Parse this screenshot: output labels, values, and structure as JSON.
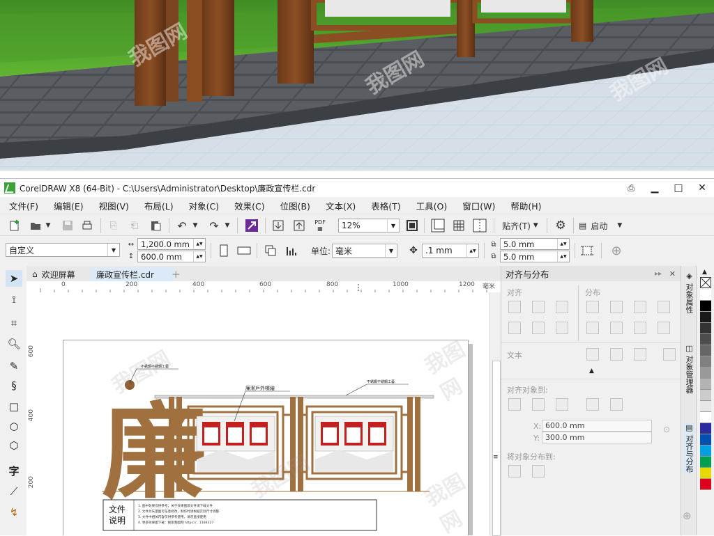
{
  "window": {
    "title": "CorelDRAW X8 (64-Bit) - C:\\Users\\Administrator\\Desktop\\廉政宣传栏.cdr",
    "minimize": "▁",
    "maximize": "□",
    "close": "✕"
  },
  "menu": [
    "文件(F)",
    "编辑(E)",
    "视图(V)",
    "布局(L)",
    "对象(C)",
    "效果(C)",
    "位图(B)",
    "文本(X)",
    "表格(T)",
    "工具(O)",
    "窗口(W)",
    "帮助(H)"
  ],
  "toolbar": {
    "pdf_label": "PDF",
    "zoom": "12%",
    "snap_label": "贴齐(T)",
    "launch_label": "启动"
  },
  "property_bar": {
    "page_preset": "自定义",
    "width": "1,200.0 mm",
    "height": "600.0 mm",
    "units_label": "单位:",
    "units_value": "毫米",
    "nudge": ".1 mm",
    "dup_x": "5.0 mm",
    "dup_y": "5.0 mm"
  },
  "tabs": {
    "welcome": "欢迎屏幕",
    "document": "廉政宣传栏.cdr",
    "add": "+"
  },
  "ruler": {
    "h_ticks": [
      "0",
      "200",
      "400",
      "600",
      "800",
      "1000",
      "1200"
    ],
    "h_unit": "毫米",
    "v_ticks": [
      "600",
      "400",
      "200"
    ]
  },
  "artwork": {
    "label_left": "不銹鋼不銹鋼工藝",
    "label_center": "廉潔戶外噴繪",
    "label_right": "不銹鋼不銹鋼工藝",
    "big_char": "廉",
    "notes_title_1": "文件",
    "notes_title_2": "说明",
    "notes_lines": [
      "1. 图中效果仅供参考，关于效果图源文件请下载文件",
      "2. 文件为矢量图可任意修改，制作时请根据实际尺寸调整",
      "3. 文件中相关内容仅供参考使用，请勿直接使用",
      "4. 更多效果图下载：搜索我图网 https://...1184327"
    ]
  },
  "docker": {
    "title": "对齐与分布",
    "align": "对齐",
    "distribute": "分布",
    "text": "文本",
    "align_to": "对齐对象到:",
    "x_label": "X:",
    "x_value": "600.0 mm",
    "y_label": "Y:",
    "y_value": "300.0 mm",
    "distribute_to": "将对象分布到:"
  },
  "side_tabs": [
    "对象属性",
    "对象管理器",
    "对齐与分布"
  ],
  "palette": {
    "colors": [
      "#ffffff",
      "#000000",
      "#1a1a1a",
      "#333333",
      "#4d4d4d",
      "#666666",
      "#808080",
      "#999999",
      "#b3b3b3",
      "#cccccc",
      "#e6e6e6",
      "#ffffff",
      "#2b2b9e",
      "#0050b0",
      "#00a0e0",
      "#00a050",
      "#e8d800",
      "#e00020"
    ]
  },
  "watermark": "我图网"
}
